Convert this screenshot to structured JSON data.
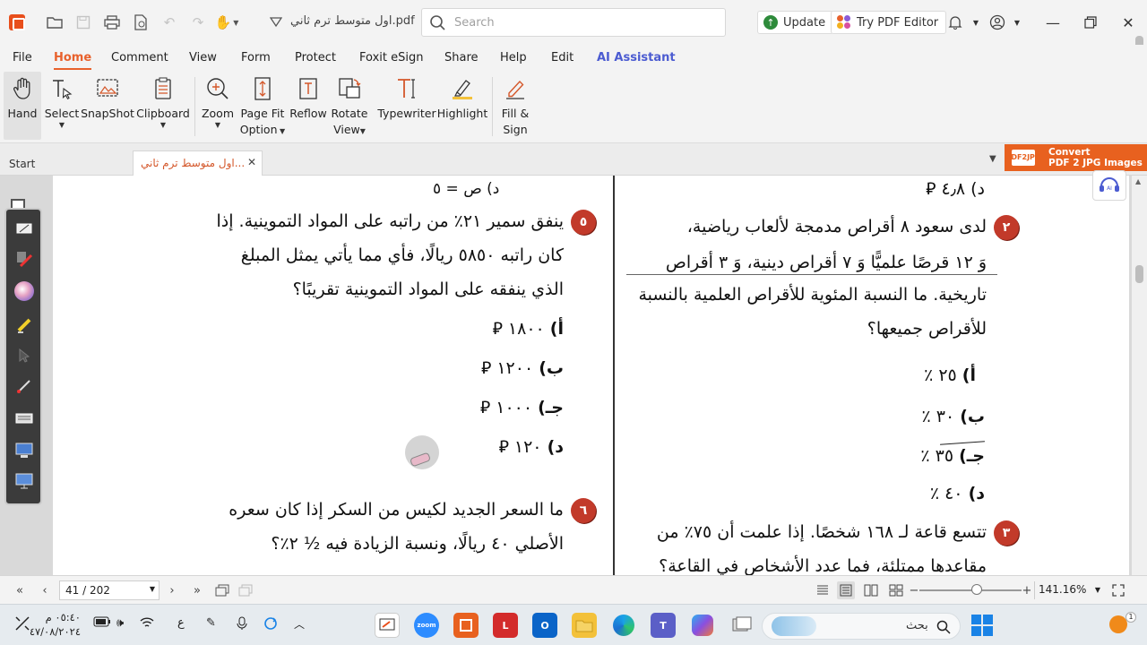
{
  "titlebar": {
    "doc_title": "اول متوسط ترم ثاني.pdf",
    "search_placeholder": "Search",
    "update_label": "Update",
    "try_editor_label": "Try PDF Editor"
  },
  "menu": {
    "tabs": [
      "File",
      "Home",
      "Comment",
      "View",
      "Form",
      "Protect",
      "Foxit eSign",
      "Share",
      "Help",
      "Edit",
      "AI Assistant"
    ],
    "active": "Home"
  },
  "ribbon": {
    "tools": [
      {
        "line1": "Hand",
        "line2": ""
      },
      {
        "line1": "Select",
        "line2": ""
      },
      {
        "line1": "SnapShot",
        "line2": ""
      },
      {
        "line1": "Clipboard",
        "line2": ""
      },
      {
        "line1": "Zoom",
        "line2": ""
      },
      {
        "line1": "Page Fit",
        "line2": "Option"
      },
      {
        "line1": "Reflow",
        "line2": ""
      },
      {
        "line1": "Rotate",
        "line2": "View"
      },
      {
        "line1": "Typewriter",
        "line2": ""
      },
      {
        "line1": "Highlight",
        "line2": ""
      },
      {
        "line1": "Fill &",
        "line2": "Sign"
      }
    ]
  },
  "tabs": {
    "start": "Start",
    "doc": "اول متوسط ترم ثاني...",
    "ad_line1": "Convert",
    "ad_line2": "PDF 2 JPG Images",
    "ad_icon": "PDF2JPG"
  },
  "page": {
    "left": {
      "top_frac": "د) ص = ٥",
      "q5_num": "٥",
      "q5_lines": [
        "ينفق سمير ٢١٪ من راتبه على المواد التموينية. إذا",
        "كان راتبه ٥٨٥٠ ريالًا، فأي مما يأتي يمثل المبلغ",
        "الذي ينفقه على المواد التموينية تقريبًا؟"
      ],
      "q5_options": [
        {
          "letter": "أ)",
          "text": "١٨٠٠ ⃁"
        },
        {
          "letter": "ب)",
          "text": "١٢٠٠ ⃁"
        },
        {
          "letter": "جـ)",
          "text": "١٠٠٠ ⃁"
        },
        {
          "letter": "د)",
          "text": "١٢٠ ⃁"
        }
      ],
      "q6_num": "٦",
      "q6_lines": [
        "ما السعر الجديد لكيس من السكر إذا كان سعره",
        "الأصلي ٤٠ ريالًا، ونسبة الزيادة فيه ½ ٢٪؟"
      ]
    },
    "right": {
      "top_option": "د) ٤٫٨ ⃁",
      "q2_num": "٢",
      "q2_lines": [
        "لدى سعود ٨ أقراص مدمجة لألعاب رياضية،",
        "وَ ١٢ قرصًا علميًّا وَ ٧ أقراص دينية، وَ ٣ أقراص",
        "تاريخية. ما النسبة المئوية للأقراص العلمية بالنسبة",
        "للأقراص جميعها؟"
      ],
      "q2_options": [
        {
          "letter": "أ)",
          "text": "٢٥ ٪"
        },
        {
          "letter": "ب)",
          "text": "٣٠ ٪"
        },
        {
          "letter": "جـ)",
          "text": "٣٥ ٪"
        },
        {
          "letter": "د)",
          "text": "٤٠ ٪"
        }
      ],
      "q3_num": "٣",
      "q3_lines": [
        "تتسع قاعة لـ ١٦٨ شخصًا. إذا علمت أن ٧٥٪ من",
        "مقاعدها ممتلئة، فما عدد الأشخاص في القاعة؟"
      ]
    }
  },
  "status": {
    "page_indicator": "41 / 202",
    "zoom": "141.16%"
  },
  "taskbar": {
    "time": "٠٥:٤٠ م",
    "date": "٤٧/٠٨/٢٠٢٤",
    "lang": "ع",
    "search_label": "بحث"
  },
  "colors": {
    "accent": "#e8612c",
    "ai_blue": "#4b5bd1",
    "qnum_red": "#c23a2a"
  }
}
